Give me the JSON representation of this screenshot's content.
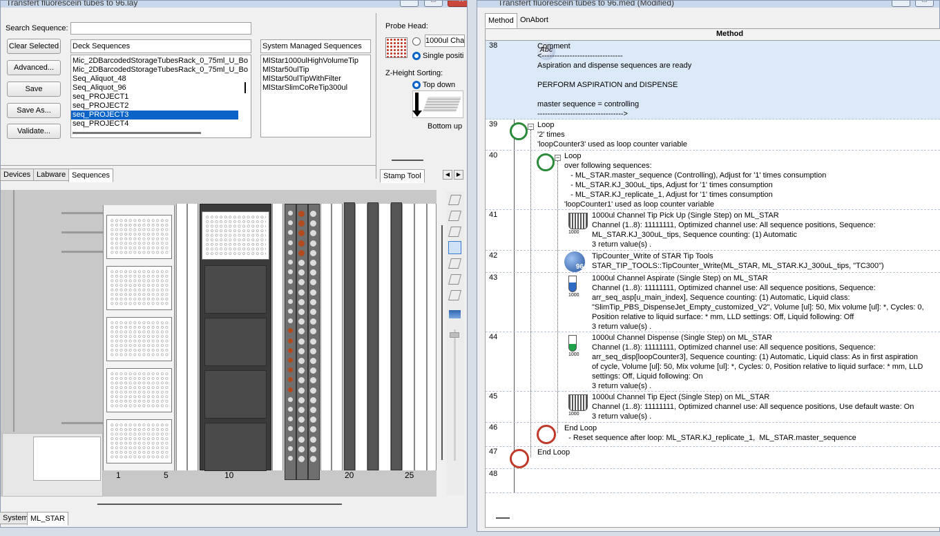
{
  "left_window": {
    "title": "Transfert fluorescein tubes to 96.lay",
    "search_label": "Search Sequence:",
    "search_value": "",
    "buttons": {
      "clear": "Clear Selected",
      "advanced": "Advanced...",
      "save": "Save",
      "save_as": "Save As...",
      "validate": "Validate..."
    },
    "deck_sequences": {
      "header": "Deck Sequences",
      "items": [
        "Mic_2DBarcodedStorageTubesRack_0_75ml_U_Bo",
        "Mic_2DBarcodedStorageTubesRack_0_75ml_U_Bo",
        "Seq_Aliquot_48",
        "Seq_Aliquot_96",
        "seq_PROJECT1",
        "seq_PROJECT2",
        "seq_PROJECT3",
        "seq_PROJECT4"
      ],
      "selected_index": 6
    },
    "system_sequences": {
      "header": "System Managed Sequences",
      "items": [
        "MlStar1000ulHighVolumeTip",
        "MlStar50ulTip",
        "MlStar50ulTipWithFilter",
        "MlStarSlimCoReTip300ul"
      ]
    },
    "probe_head": {
      "label": "Probe Head:",
      "opt1": "1000ul Cha",
      "opt2": "Single positi"
    },
    "zheight": {
      "label": "Z-Height Sorting:",
      "opt1": "Top down",
      "opt2": "Bottom up"
    },
    "tabs": [
      "Devices",
      "Labware",
      "Sequences"
    ],
    "active_tab": "Sequences",
    "stamp_tab": "Stamp Tool",
    "deck_axis": [
      "1",
      "5",
      "10",
      "20",
      "25"
    ],
    "bottom_tabs": [
      "System",
      "ML_STAR"
    ]
  },
  "right_window": {
    "title": "Transfert fluorescein tubes to 96.med (Modified)",
    "tabs": [
      "Method",
      "OnAbort"
    ],
    "column_header": "Method",
    "rows": [
      {
        "num": "38",
        "lines": [
          "Comment",
          "<--------------------------------",
          "Aspiration and dispense sequences are ready",
          "",
          "PERFORM ASPIRATION and DISPENSE",
          "",
          "master sequence = controlling",
          "---------------------------------->"
        ]
      },
      {
        "num": "39",
        "lines": [
          "Loop",
          "'2' times",
          "'loopCounter3' used as loop counter variable"
        ]
      },
      {
        "num": "40",
        "lines": [
          "Loop",
          "over following sequences:",
          "   - ML_STAR.master_sequence (Controlling), Adjust for '1' times consumption",
          "   - ML_STAR.KJ_300uL_tips, Adjust for '1' times consumption",
          "   - ML_STAR.KJ_replicate_1, Adjust for '1' times consumption",
          "'loopCounter1' used as loop counter variable"
        ]
      },
      {
        "num": "41",
        "lines": [
          "1000ul Channel Tip Pick Up (Single Step) on ML_STAR",
          "Channel (1..8): 11111111, Optimized channel use: All sequence positions, Sequence:",
          "ML_STAR.KJ_300uL_tips, Sequence counting: (1) Automatic",
          "3 return value(s) ."
        ]
      },
      {
        "num": "42",
        "lines": [
          "TipCounter_Write of STAR Tip Tools",
          "STAR_TIP_TOOLS::TipCounter_Write(ML_STAR, ML_STAR.KJ_300uL_tips, \"TC300\")"
        ]
      },
      {
        "num": "43",
        "lines": [
          "1000ul Channel Aspirate (Single Step) on ML_STAR",
          "Channel (1..8): 11111111, Optimized channel use: All sequence positions, Sequence:",
          "arr_seq_asp[u_main_index], Sequence counting: (1) Automatic, Liquid class:",
          "\"SlimTip_PBS_DispenseJet_Empty_customized_V2\", Volume [ul]: 50, Mix volume [ul]: *, Cycles: 0,",
          "Position relative to liquid surface: * mm, LLD settings: Off, Liquid following: Off",
          "3 return value(s) ."
        ]
      },
      {
        "num": "44",
        "lines": [
          "1000ul Channel Dispense (Single Step) on ML_STAR",
          "Channel (1..8): 11111111, Optimized channel use: All sequence positions, Sequence:",
          "arr_seq_disp[loopCounter3], Sequence counting: (1) Automatic, Liquid class: As in first aspiration",
          "of cycle, Volume [ul]: 50, Mix volume [ul]: *, Cycles: 0, Position relative to liquid surface: * mm, LLD",
          "settings: Off, Liquid following: On",
          "3 return value(s) ."
        ]
      },
      {
        "num": "45",
        "lines": [
          "1000ul Channel Tip Eject (Single Step) on ML_STAR",
          "Channel (1..8): 11111111, Optimized channel use: All sequence positions, Use default waste: On",
          "3 return value(s) ."
        ]
      },
      {
        "num": "46",
        "lines": [
          "End Loop",
          "  - Reset sequence after loop: ML_STAR.KJ_replicate_1,  ML_STAR.master_sequence"
        ]
      },
      {
        "num": "47",
        "lines": [
          "End Loop"
        ]
      },
      {
        "num": "48",
        "lines": []
      }
    ],
    "icon_labels": {
      "tip": "1000",
      "tipcounter": "96",
      "comment": "Abc"
    }
  },
  "colors": {
    "selection": "#0a64c8",
    "comment_bg": "#dce9f8",
    "tube_orange": "#b34a1d"
  }
}
